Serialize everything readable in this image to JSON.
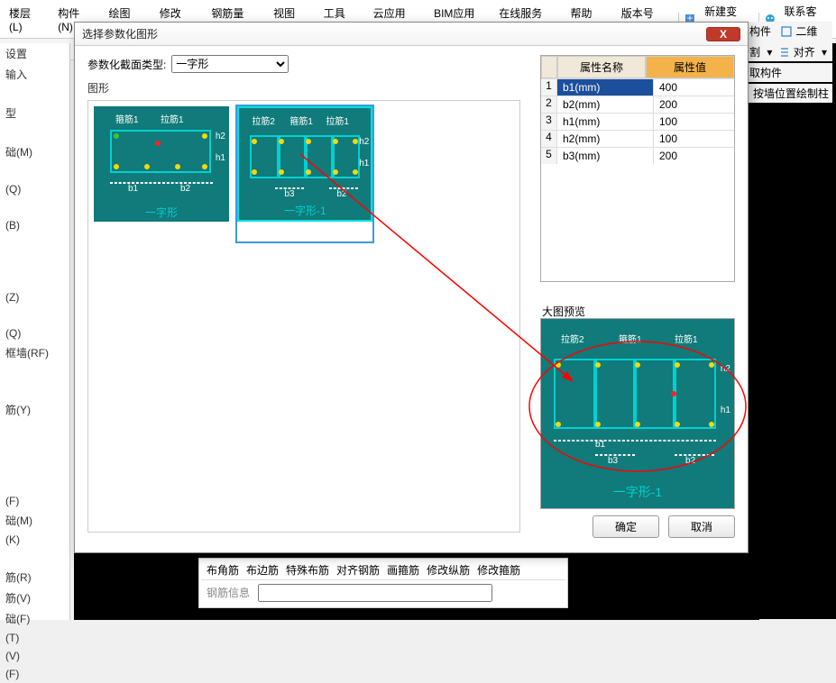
{
  "menu": {
    "items": [
      "楼层(L)",
      "构件(N)",
      "绘图(D)",
      "修改(M)",
      "钢筋量(Q)",
      "视图(V)",
      "工具(T)",
      "云应用(Y)",
      "BIM应用(I)",
      "在线服务(S)",
      "帮助(H)",
      "版本号(B)"
    ],
    "new_change": "新建变更",
    "contact": "联系客服"
  },
  "right_tools": {
    "yong_component": "用构件",
    "two_d": "二维",
    "split": "分割",
    "align": "对齐",
    "get_component": "拾取构件",
    "draw_by_position": "按墙位置绘制柱"
  },
  "left_panel": {
    "items": [
      "设置",
      "输入",
      "",
      "型",
      "",
      "础(M)",
      "",
      "(Q)",
      "",
      "(B)",
      "",
      "",
      "",
      "(Z)",
      "",
      "(Q)",
      "框墙(RF)",
      "",
      "",
      "筋(Y)",
      "",
      "",
      "",
      "",
      "(F)",
      "础(M)",
      "(K)",
      "",
      "筋(R)",
      "筋(V)",
      "础(F)",
      "(T)",
      "(V)",
      "(F)"
    ]
  },
  "dialog": {
    "title": "选择参数化图形",
    "type_label": "参数化截面类型:",
    "type_value": "一字形",
    "shapes_label": "图形",
    "shapes": [
      {
        "label": "一字形",
        "tags": [
          "箍筋1",
          "拉筋1"
        ],
        "dims": [
          "b1",
          "b2",
          "h1",
          "h2"
        ]
      },
      {
        "label": "一字形-1",
        "tags": [
          "拉筋2",
          "箍筋1",
          "拉筋1"
        ],
        "dims": [
          "b3",
          "b2",
          "h1",
          "h2"
        ]
      }
    ],
    "attr_header": {
      "name": "属性名称",
      "value": "属性值"
    },
    "attrs": [
      {
        "idx": "1",
        "name": "b1(mm)",
        "value": "400"
      },
      {
        "idx": "2",
        "name": "b2(mm)",
        "value": "200"
      },
      {
        "idx": "3",
        "name": "h1(mm)",
        "value": "100"
      },
      {
        "idx": "4",
        "name": "h2(mm)",
        "value": "100"
      },
      {
        "idx": "5",
        "name": "b3(mm)",
        "value": "200"
      }
    ],
    "preview_label": "大图预览",
    "preview_shape_label": "一字形-1",
    "preview_tags": [
      "拉筋2",
      "箍筋1",
      "拉筋1"
    ],
    "preview_dims": [
      "b1",
      "b3",
      "b2",
      "h1",
      "h2"
    ],
    "ok": "确定",
    "cancel": "取消"
  },
  "bottom": {
    "tabs": [
      "布角筋",
      "布边筋",
      "特殊布筋",
      "对齐钢筋",
      "画箍筋",
      "修改纵筋",
      "修改箍筋"
    ],
    "info_label": "钢筋信息"
  }
}
